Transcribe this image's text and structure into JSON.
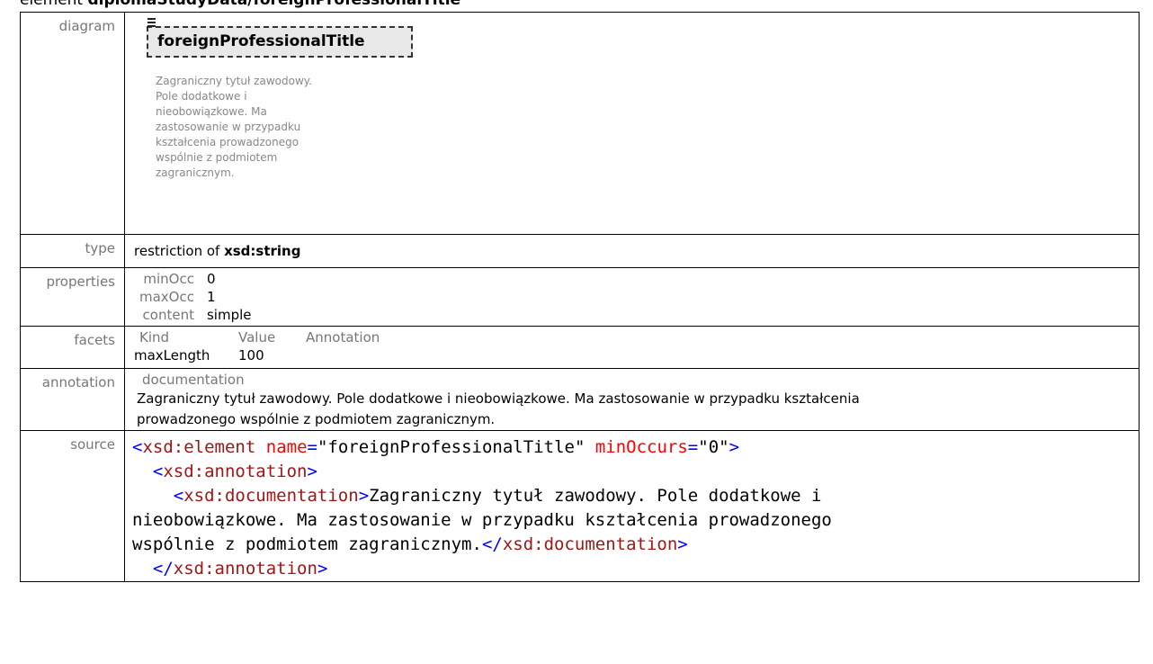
{
  "heading": {
    "prefix": "element ",
    "path": "diplomaStudyData/foreignProfessionalTitle"
  },
  "labels": {
    "diagram": "diagram",
    "type": "type",
    "properties": "properties",
    "facets": "facets",
    "annotation": "annotation",
    "source": "source"
  },
  "diagram": {
    "element_name": "foreignProfessionalTitle",
    "doc_lines": [
      "Zagraniczny tytuł zawodowy.",
      "Pole dodatkowe i",
      "nieobowiązkowe. Ma",
      "zastosowanie w przypadku",
      "kształcenia prowadzonego",
      "wspólnie z podmiotem",
      "zagranicznym."
    ]
  },
  "type": {
    "prefix": "restriction of ",
    "base": "xsd:string"
  },
  "properties": [
    {
      "key": "minOcc",
      "value": "0"
    },
    {
      "key": "maxOcc",
      "value": "1"
    },
    {
      "key": "content",
      "value": "simple"
    }
  ],
  "facets": {
    "headers": [
      "Kind",
      "Value",
      "Annotation"
    ],
    "rows": [
      {
        "kind": "maxLength",
        "value": "100",
        "annotation": ""
      }
    ]
  },
  "annotation": {
    "label": "documentation",
    "text_lines": [
      "Zagraniczny tytuł zawodowy. Pole dodatkowe i nieobowiązkowe. Ma zastosowanie w przypadku kształcenia",
      "prowadzonego wspólnie z podmiotem zagranicznym."
    ]
  },
  "source": {
    "line1": {
      "open": "<",
      "tag": "xsd:element",
      "attr1": "name",
      "eq1": "=",
      "val1": "\"foreignProfessionalTitle\"",
      "attr2": "minOccurs",
      "eq2": "=",
      "val2": "\"0\"",
      "close": ">"
    },
    "line2": {
      "indent": "  ",
      "open": "<",
      "tag": "xsd:annotation",
      "close": ">"
    },
    "line3": {
      "indent": "    ",
      "open": "<",
      "tag": "xsd:documentation",
      "close": ">",
      "text": "Zagraniczny tytuł zawodowy. Pole dodatkowe i"
    },
    "line4": {
      "text": "nieobowiązkowe. Ma zastosowanie w przypadku kształcenia prowadzonego"
    },
    "line5": {
      "text": "wspólnie z podmiotem zagranicznym.",
      "open": "</",
      "tag": "xsd:documentation",
      "close": ">"
    },
    "line6": {
      "indent": "  ",
      "open": "</",
      "tag": "xsd:annotation",
      "close": ">"
    }
  },
  "colors": {
    "tag": "#a31515",
    "bracket": "#0000ff",
    "attribute": "#ff0000",
    "value": "#0000ff",
    "label": "#777777"
  }
}
